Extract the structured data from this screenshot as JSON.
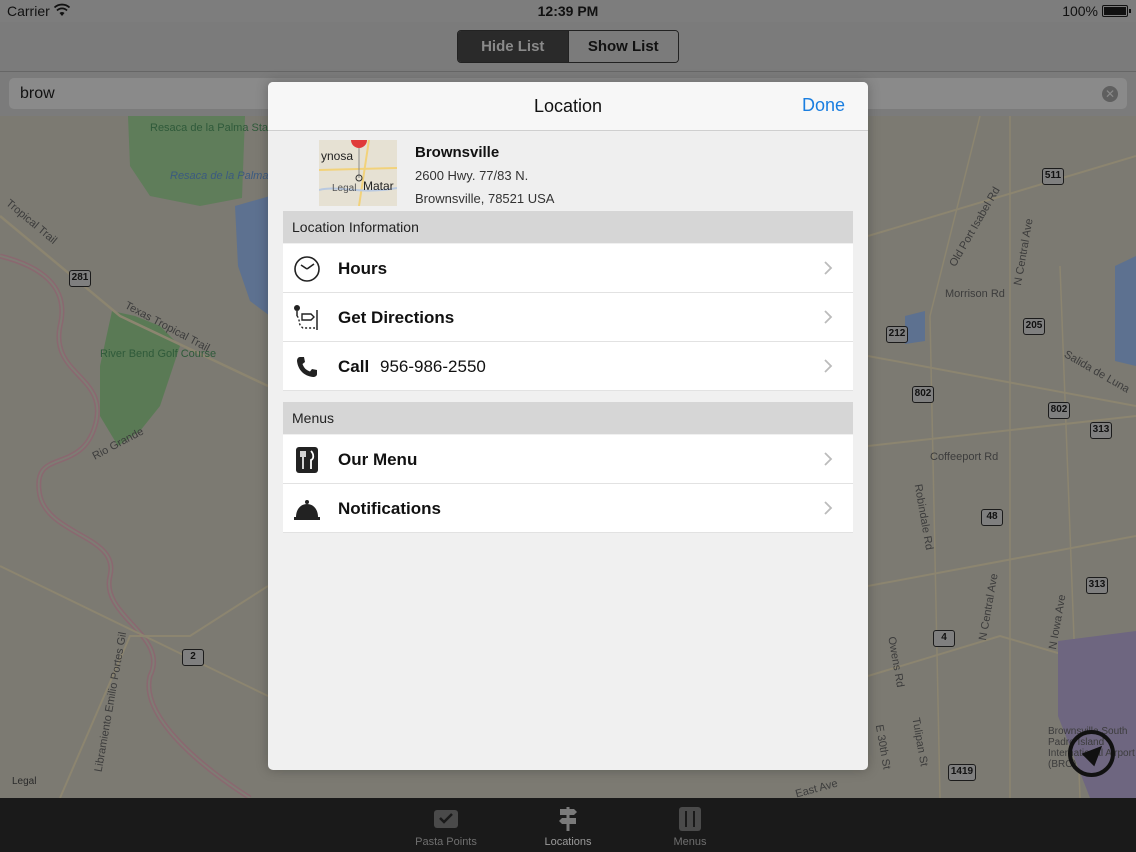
{
  "status_bar": {
    "carrier": "Carrier",
    "time": "12:39 PM",
    "battery": "100%"
  },
  "nav": {
    "segments": [
      "Hide List",
      "Show List"
    ],
    "active_segment": "Hide List"
  },
  "search": {
    "value": "brow"
  },
  "map": {
    "labels": {
      "resaca_park": "Resaca de la Palma State Park",
      "resaca_water": "Resaca de la Palma",
      "tropical_trail_1": "Tropical Trail",
      "tropical_trail_2": "Texas Tropical Trail",
      "golf": "River Bend Golf Course",
      "rio_grande": "Rio Grande",
      "libramiento": "Libramiento Emilio Portes Gil",
      "old_port": "Old Port Isabel Rd",
      "n_central_top": "N Central Ave",
      "morrison": "Morrison Rd",
      "salida": "Salida de Luna",
      "coffeeport": "Coffeeport Rd",
      "robindale": "Robindale Rd",
      "n_central_bottom": "N Central Ave",
      "n_iowa": "N Iowa Ave",
      "owens": "Owens Rd",
      "e30th": "E 30th St",
      "tulipan": "Tulipan St",
      "east_ave": "East Ave",
      "airport": "Brownsville South Padre Island International Airport (BRO)"
    },
    "shields": [
      "281",
      "511",
      "212",
      "205",
      "802",
      "802",
      "313",
      "48",
      "313",
      "4",
      "2",
      "1419"
    ],
    "legal": "Legal"
  },
  "modal": {
    "title": "Location",
    "done": "Done",
    "location": {
      "name": "Brownsville",
      "address_line1": "2600 Hwy. 77/83 N.",
      "address_line2": "Brownsville, 78521 USA",
      "thumb_text_1": "ynosa",
      "thumb_text_2": "Matar",
      "thumb_legal": "Legal"
    },
    "sections": [
      {
        "header": "Location Information",
        "rows": [
          {
            "label": "Hours",
            "icon": "clock-icon"
          },
          {
            "label": "Get Directions",
            "icon": "directions-icon"
          },
          {
            "label": "Call",
            "phone": "956-986-2550",
            "icon": "phone-icon"
          }
        ]
      },
      {
        "header": "Menus",
        "rows": [
          {
            "label": "Our Menu",
            "icon": "fork-knife-icon"
          },
          {
            "label": "Notifications",
            "icon": "bell-icon"
          }
        ]
      }
    ]
  },
  "tab_bar": {
    "tabs": [
      {
        "label": "Pasta Points",
        "icon": "points-icon"
      },
      {
        "label": "Locations",
        "icon": "signpost-icon"
      },
      {
        "label": "Menus",
        "icon": "menu-icon"
      }
    ],
    "active": "Locations"
  }
}
